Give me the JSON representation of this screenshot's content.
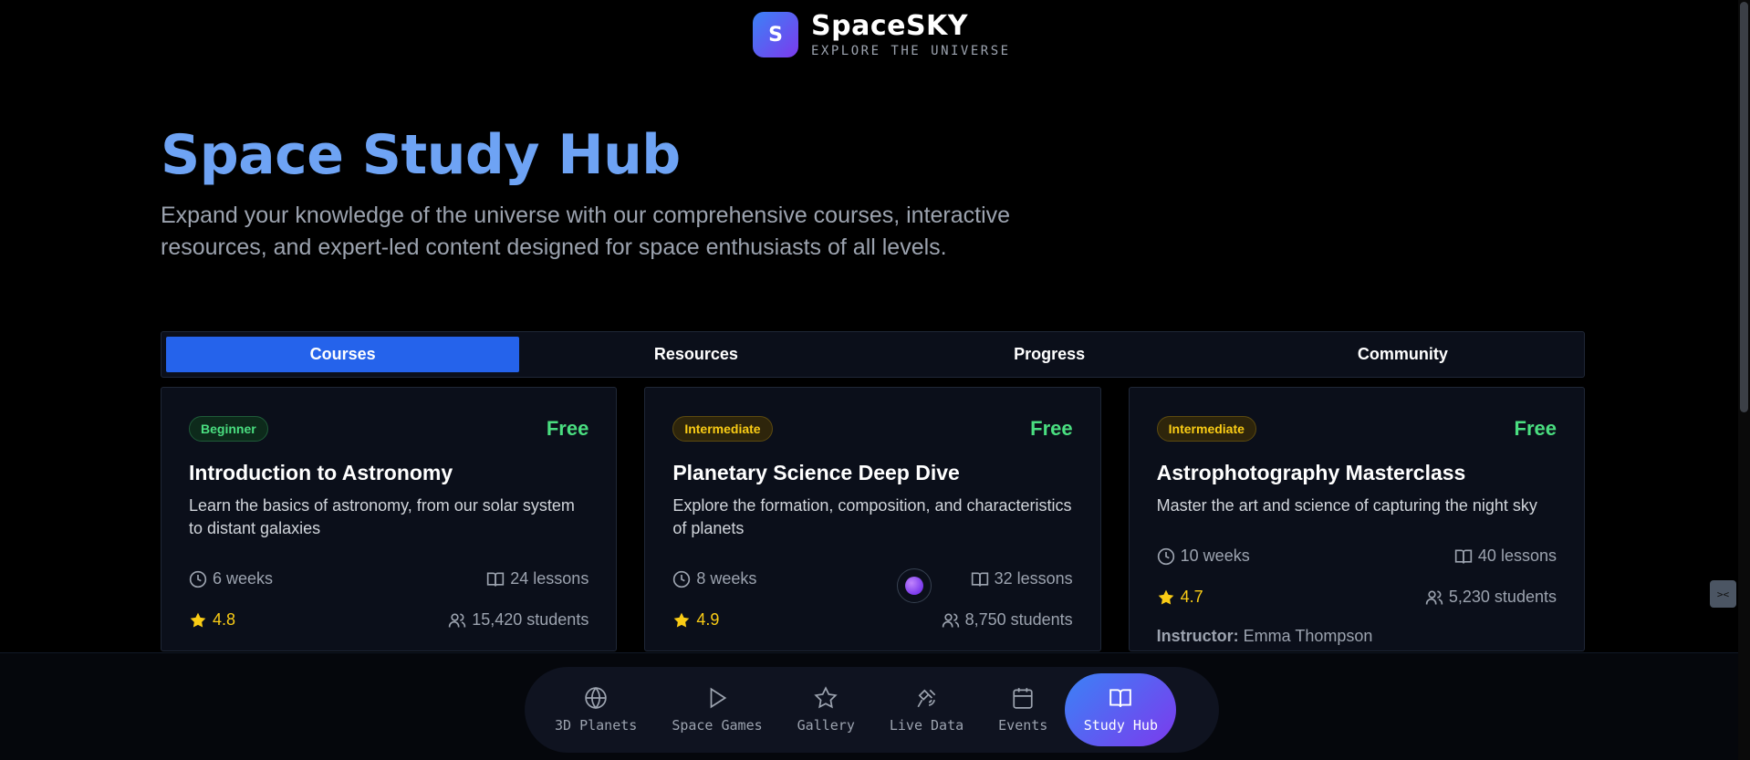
{
  "brand": {
    "logo_letter": "S",
    "name": "SpaceSKY",
    "tagline": "EXPLORE THE UNIVERSE"
  },
  "hero": {
    "title": "Space Study Hub",
    "description": "Expand your knowledge of the universe with our comprehensive courses, interactive resources, and expert-led content designed for space enthusiasts of all levels."
  },
  "tabs": [
    {
      "label": "Courses",
      "active": true
    },
    {
      "label": "Resources",
      "active": false
    },
    {
      "label": "Progress",
      "active": false
    },
    {
      "label": "Community",
      "active": false
    }
  ],
  "courses": [
    {
      "level": "Beginner",
      "price": "Free",
      "title": "Introduction to Astronomy",
      "description": "Learn the basics of astronomy, from our solar system to distant galaxies",
      "duration": "6 weeks",
      "lessons": "24 lessons",
      "rating": "4.8",
      "students": "15,420 students"
    },
    {
      "level": "Intermediate",
      "price": "Free",
      "title": "Planetary Science Deep Dive",
      "description": "Explore the formation, composition, and characteristics of planets",
      "duration": "8 weeks",
      "lessons": "32 lessons",
      "rating": "4.9",
      "students": "8,750 students"
    },
    {
      "level": "Intermediate",
      "price": "Free",
      "title": "Astrophotography Masterclass",
      "description": "Master the art and science of capturing the night sky",
      "duration": "10 weeks",
      "lessons": "40 lessons",
      "rating": "4.7",
      "students": "5,230 students",
      "instructor_label": "Instructor:",
      "instructor": "Emma Thompson"
    }
  ],
  "bottom_nav": [
    {
      "label": "3D Planets",
      "icon": "globe-icon",
      "active": false
    },
    {
      "label": "Space Games",
      "icon": "play-icon",
      "active": false
    },
    {
      "label": "Gallery",
      "icon": "star-icon",
      "active": false
    },
    {
      "label": "Live Data",
      "icon": "satellite-icon",
      "active": false
    },
    {
      "label": "Events",
      "icon": "calendar-icon",
      "active": false
    },
    {
      "label": "Study Hub",
      "icon": "book-icon",
      "active": true
    }
  ],
  "colors": {
    "accent_blue": "#2563eb",
    "hero_title": "#6ea3f4",
    "free_green": "#4ade80",
    "rating_yellow": "#facc15"
  }
}
